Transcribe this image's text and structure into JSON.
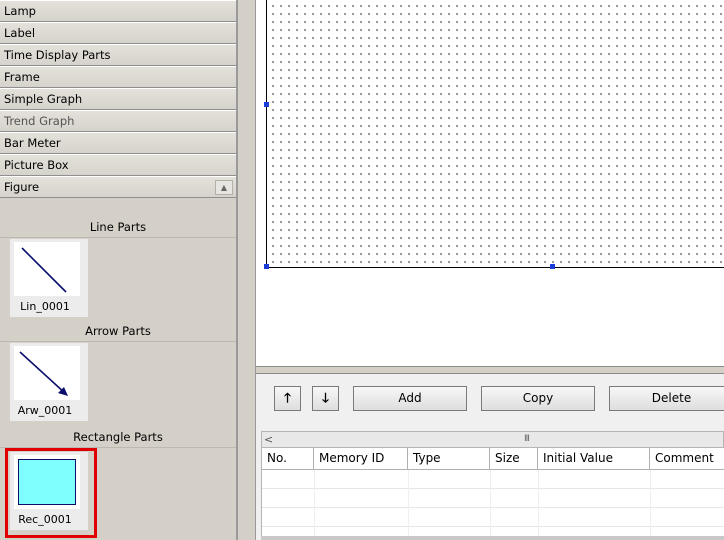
{
  "palette": {
    "categories": [
      {
        "label": "Lamp"
      },
      {
        "label": "Label"
      },
      {
        "label": "Time Display Parts"
      },
      {
        "label": "Frame"
      },
      {
        "label": "Simple Graph"
      },
      {
        "label": "Trend Graph"
      },
      {
        "label": "Bar Meter"
      },
      {
        "label": "Picture Box"
      },
      {
        "label": "Figure"
      }
    ],
    "scroll_up_icon": "triangle-up",
    "sections": [
      {
        "title": "Line Parts",
        "part_label": "Lin_0001"
      },
      {
        "title": "Arrow Parts",
        "part_label": "Arw_0001"
      },
      {
        "title": "Rectangle Parts",
        "part_label": "Rec_0001"
      }
    ],
    "colors": {
      "rect_fill": "#80ffff",
      "line_stroke": "#0b0d6b",
      "highlight": "#e00000"
    }
  },
  "canvas": {
    "background": "#ffffff",
    "handle_color": "#1e3cd8"
  },
  "toolbar": {
    "up_icon": "arrow-up-icon",
    "down_icon": "arrow-down-icon",
    "up_glyph": "🡑",
    "down_glyph": "🡓",
    "add_label": "Add",
    "copy_label": "Copy",
    "delete_label": "Delete"
  },
  "table": {
    "scroll_left_glyph": "<",
    "scroll_grip_glyph": "III",
    "columns": [
      "No.",
      "Memory ID",
      "Type",
      "Size",
      "Initial Value",
      "Comment"
    ],
    "rows": []
  }
}
